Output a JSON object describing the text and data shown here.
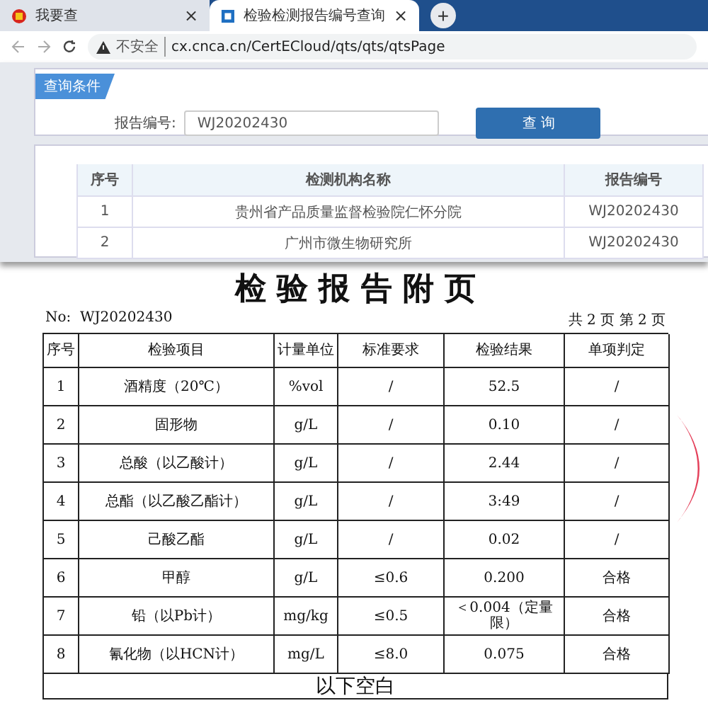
{
  "browser": {
    "tabs": [
      {
        "title": "我要查",
        "selected": false,
        "close": "×"
      },
      {
        "title": "检验检测报告编号查询",
        "selected": true,
        "close": "×"
      }
    ],
    "new_tab": "+",
    "security": "不安全",
    "url": "cx.cnca.cn/CertECloud/qts/qts/qtsPage"
  },
  "query": {
    "title": "查询条件",
    "label": "报告编号:",
    "value": "WJ20202430",
    "button": "查 询"
  },
  "results": {
    "columns": [
      "序号",
      "检测机构名称",
      "报告编号"
    ],
    "rows": [
      [
        "1",
        "贵州省产品质量监督检验院仁怀分院",
        "WJ20202430"
      ],
      [
        "2",
        "广州市微生物研究所",
        "WJ20202430"
      ]
    ]
  },
  "report": {
    "title": "检 验 报 告 附 页",
    "number": "No:  WJ20202430",
    "pages": "共 2 页 第 2 页",
    "columns": [
      "序号",
      "检验项目",
      "计量单位",
      "标准要求",
      "检验结果",
      "单项判定"
    ],
    "rows": [
      [
        "1",
        "酒精度（20℃）",
        "%vol",
        "/",
        "52.5",
        "/"
      ],
      [
        "2",
        "固形物",
        "g/L",
        "/",
        "0.10",
        "/"
      ],
      [
        "3",
        "总酸（以乙酸计）",
        "g/L",
        "/",
        "2.44",
        "/"
      ],
      [
        "4",
        "总酯（以乙酸乙酯计）",
        "g/L",
        "/",
        "3:49",
        "/"
      ],
      [
        "5",
        "己酸乙酯",
        "g/L",
        "/",
        "0.02",
        "/"
      ],
      [
        "6",
        "甲醇",
        "g/L",
        "≤0.6",
        "0.200",
        "合格"
      ],
      [
        "7",
        "铅（以Pb计）",
        "mg/kg",
        "≤0.5",
        "＜0.004（定量限）",
        "合格"
      ],
      [
        "8",
        "氰化物（以HCN计）",
        "mg/L",
        "≤8.0",
        "0.075",
        "合格"
      ]
    ],
    "footer": "以下空白"
  }
}
